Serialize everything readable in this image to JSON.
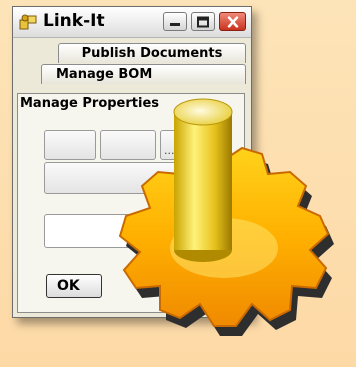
{
  "window": {
    "title": "Link-It",
    "controls": {
      "minimize": "minimize",
      "maximize": "maximize",
      "close": "close"
    }
  },
  "tabs": [
    {
      "label": "Publish Documents"
    },
    {
      "label": "Manage BOM"
    },
    {
      "label": "Manage Properties"
    }
  ],
  "fields": {
    "browse_dots": "..."
  },
  "buttons": {
    "ok_label": "OK"
  },
  "icons": {
    "app": "link-it-app-icon",
    "gear": "yellow-gear-with-cylinder-icon"
  },
  "colors": {
    "background": "#fdd9a6",
    "window": "#ece9d8",
    "close_button": "#c8331e",
    "gear": "#ffb400"
  }
}
